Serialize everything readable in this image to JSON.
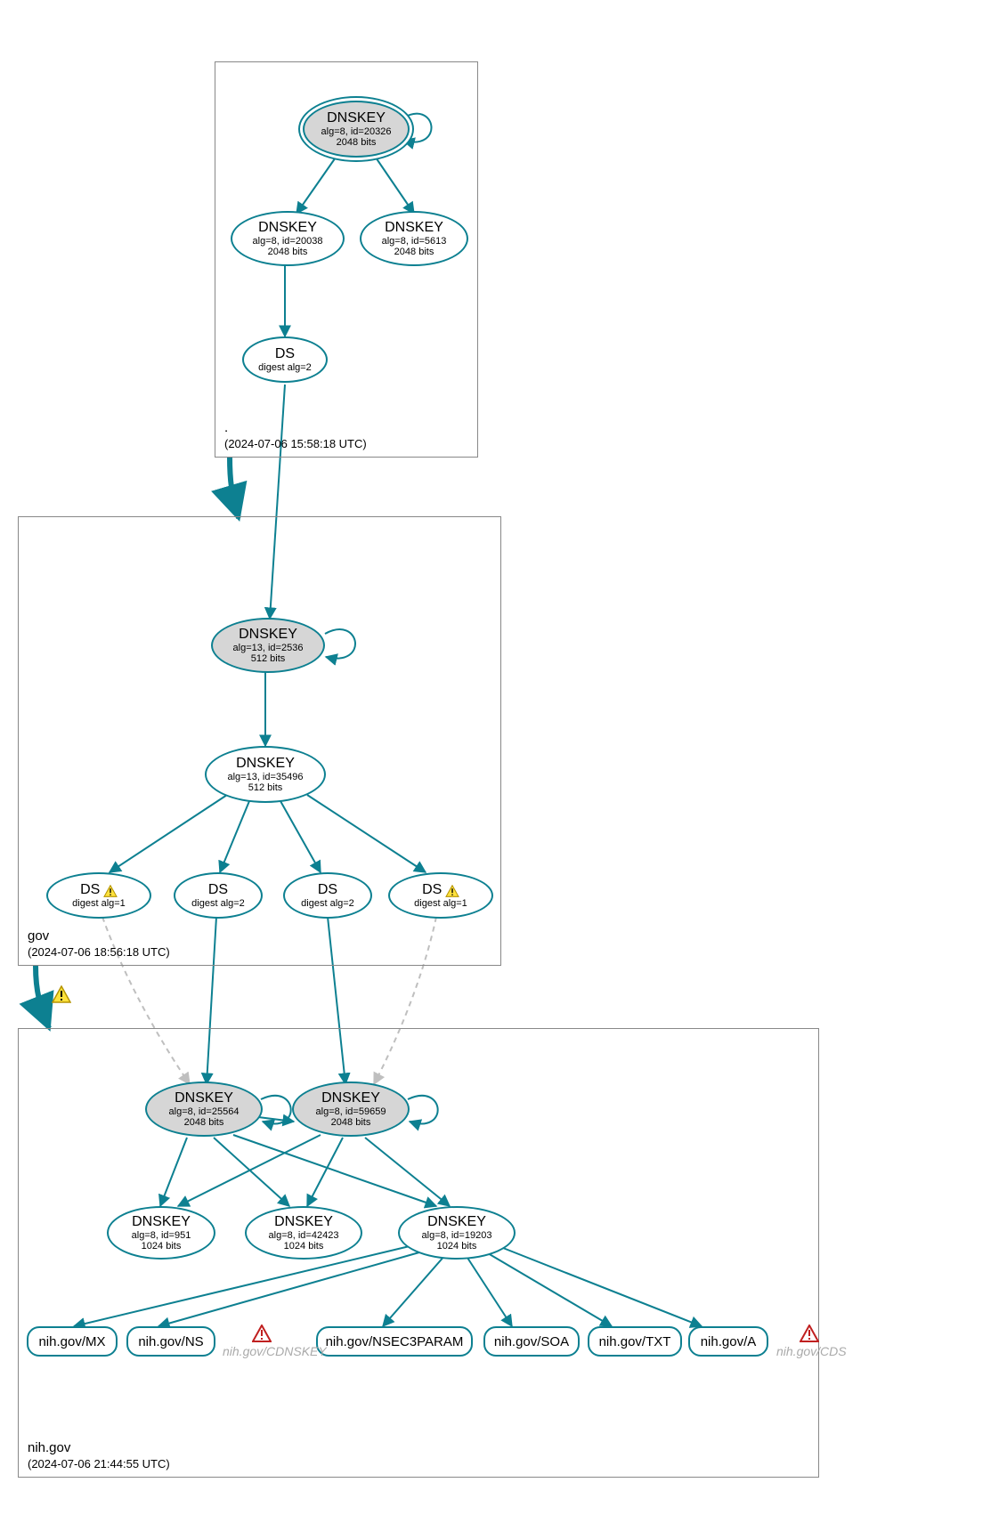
{
  "zones": {
    "root": {
      "name": ".",
      "timestamp": "(2024-07-06 15:58:18 UTC)"
    },
    "gov": {
      "name": "gov",
      "timestamp": "(2024-07-06 18:56:18 UTC)"
    },
    "nih": {
      "name": "nih.gov",
      "timestamp": "(2024-07-06 21:44:55 UTC)"
    }
  },
  "nodes": {
    "root_ksk": {
      "title": "DNSKEY",
      "sub1": "alg=8, id=20326",
      "sub2": "2048 bits"
    },
    "root_zsk1": {
      "title": "DNSKEY",
      "sub1": "alg=8, id=20038",
      "sub2": "2048 bits"
    },
    "root_zsk2": {
      "title": "DNSKEY",
      "sub1": "alg=8, id=5613",
      "sub2": "2048 bits"
    },
    "root_ds": {
      "title": "DS",
      "sub1": "digest alg=2"
    },
    "gov_ksk": {
      "title": "DNSKEY",
      "sub1": "alg=13, id=2536",
      "sub2": "512 bits"
    },
    "gov_zsk": {
      "title": "DNSKEY",
      "sub1": "alg=13, id=35496",
      "sub2": "512 bits"
    },
    "gov_ds1": {
      "title": "DS",
      "sub1": "digest alg=1"
    },
    "gov_ds2": {
      "title": "DS",
      "sub1": "digest alg=2"
    },
    "gov_ds3": {
      "title": "DS",
      "sub1": "digest alg=2"
    },
    "gov_ds4": {
      "title": "DS",
      "sub1": "digest alg=1"
    },
    "nih_ksk1": {
      "title": "DNSKEY",
      "sub1": "alg=8, id=25564",
      "sub2": "2048 bits"
    },
    "nih_ksk2": {
      "title": "DNSKEY",
      "sub1": "alg=8, id=59659",
      "sub2": "2048 bits"
    },
    "nih_zsk1": {
      "title": "DNSKEY",
      "sub1": "alg=8, id=951",
      "sub2": "1024 bits"
    },
    "nih_zsk2": {
      "title": "DNSKEY",
      "sub1": "alg=8, id=42423",
      "sub2": "1024 bits"
    },
    "nih_zsk3": {
      "title": "DNSKEY",
      "sub1": "alg=8, id=19203",
      "sub2": "1024 bits"
    }
  },
  "rr": {
    "mx": "nih.gov/MX",
    "ns": "nih.gov/NS",
    "n3p": "nih.gov/NSEC3PARAM",
    "soa": "nih.gov/SOA",
    "txt": "nih.gov/TXT",
    "a": "nih.gov/A"
  },
  "ghost": {
    "cdnskey": "nih.gov/CDNSKEY",
    "cds": "nih.gov/CDS"
  },
  "colors": {
    "stroke": "#0d8091",
    "dashed": "#bfbfbf",
    "warnFill": "#ffe23d",
    "warnStroke": "#b59400",
    "errStroke": "#c02020"
  }
}
